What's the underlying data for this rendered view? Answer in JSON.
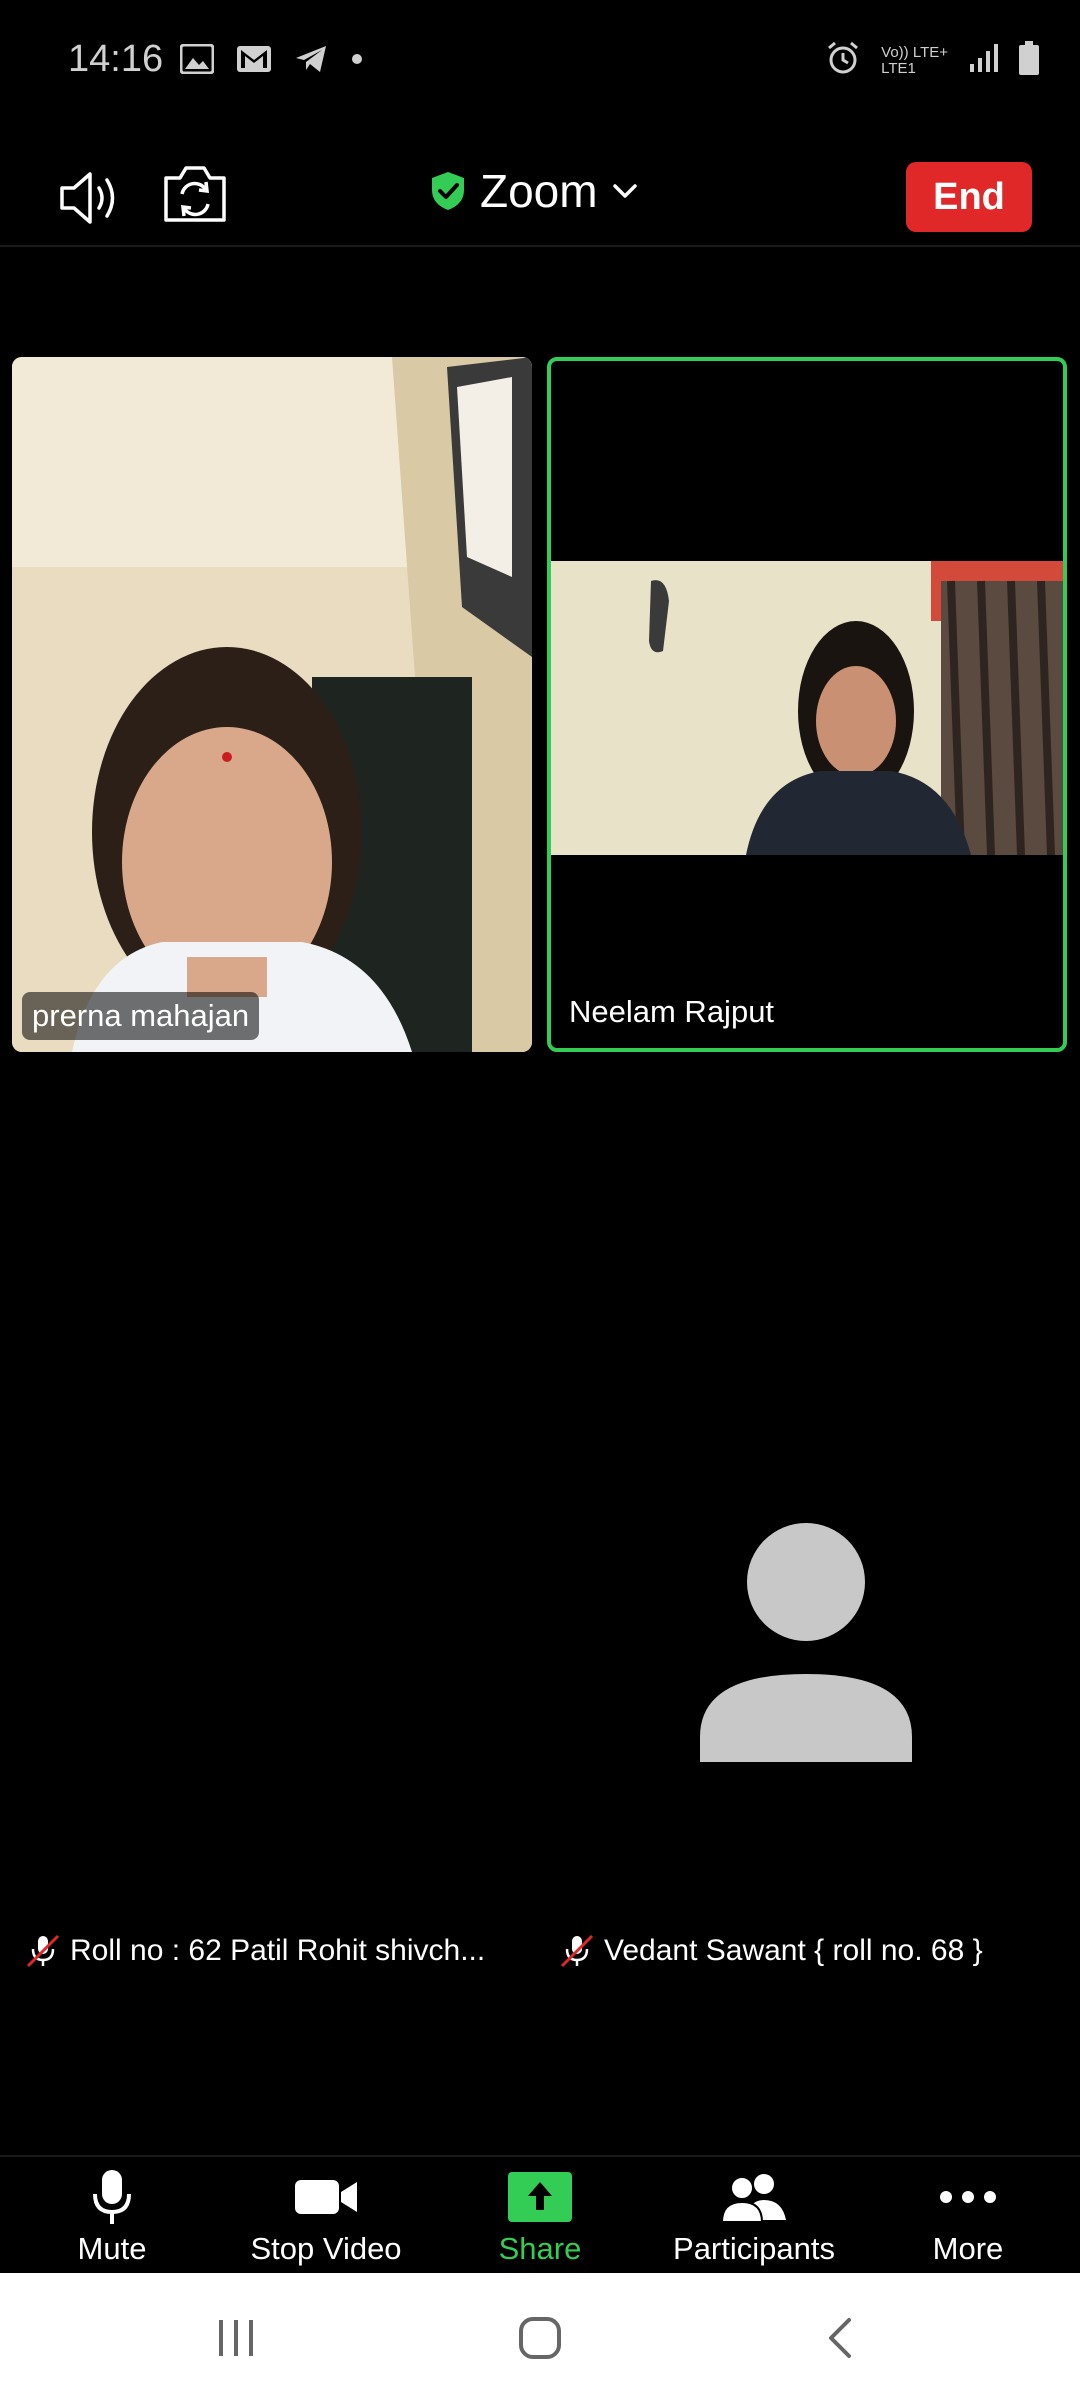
{
  "status_bar": {
    "time": "14:16",
    "left_icons": [
      "gallery-icon",
      "gmail-icon",
      "telegram-icon",
      "dot-icon"
    ],
    "right_icons": [
      "alarm-icon",
      "volte-lte-icon",
      "signal-icon",
      "battery-icon"
    ],
    "network_label_top": "Vo)) LTE+",
    "network_label_bottom": "LTE1"
  },
  "meeting_bar": {
    "title": "Zoom",
    "end_label": "End"
  },
  "tiles": [
    {
      "name": "prerna mahajan",
      "active_speaker": false
    },
    {
      "name": "Neelam Rajput",
      "active_speaker": true
    }
  ],
  "muted_participants": [
    {
      "label": "Roll no :  62 Patil Rohit shivch..."
    },
    {
      "label": "Vedant Sawant { roll no. 68 }"
    }
  ],
  "toolbar": {
    "mute_label": "Mute",
    "stop_video_label": "Stop Video",
    "share_label": "Share",
    "participants_label": "Participants",
    "more_label": "More"
  },
  "colors": {
    "end_button": "#e02828",
    "active_speaker_border": "#33cc55",
    "share_accent": "#33cc55",
    "shield": "#33cc55"
  }
}
